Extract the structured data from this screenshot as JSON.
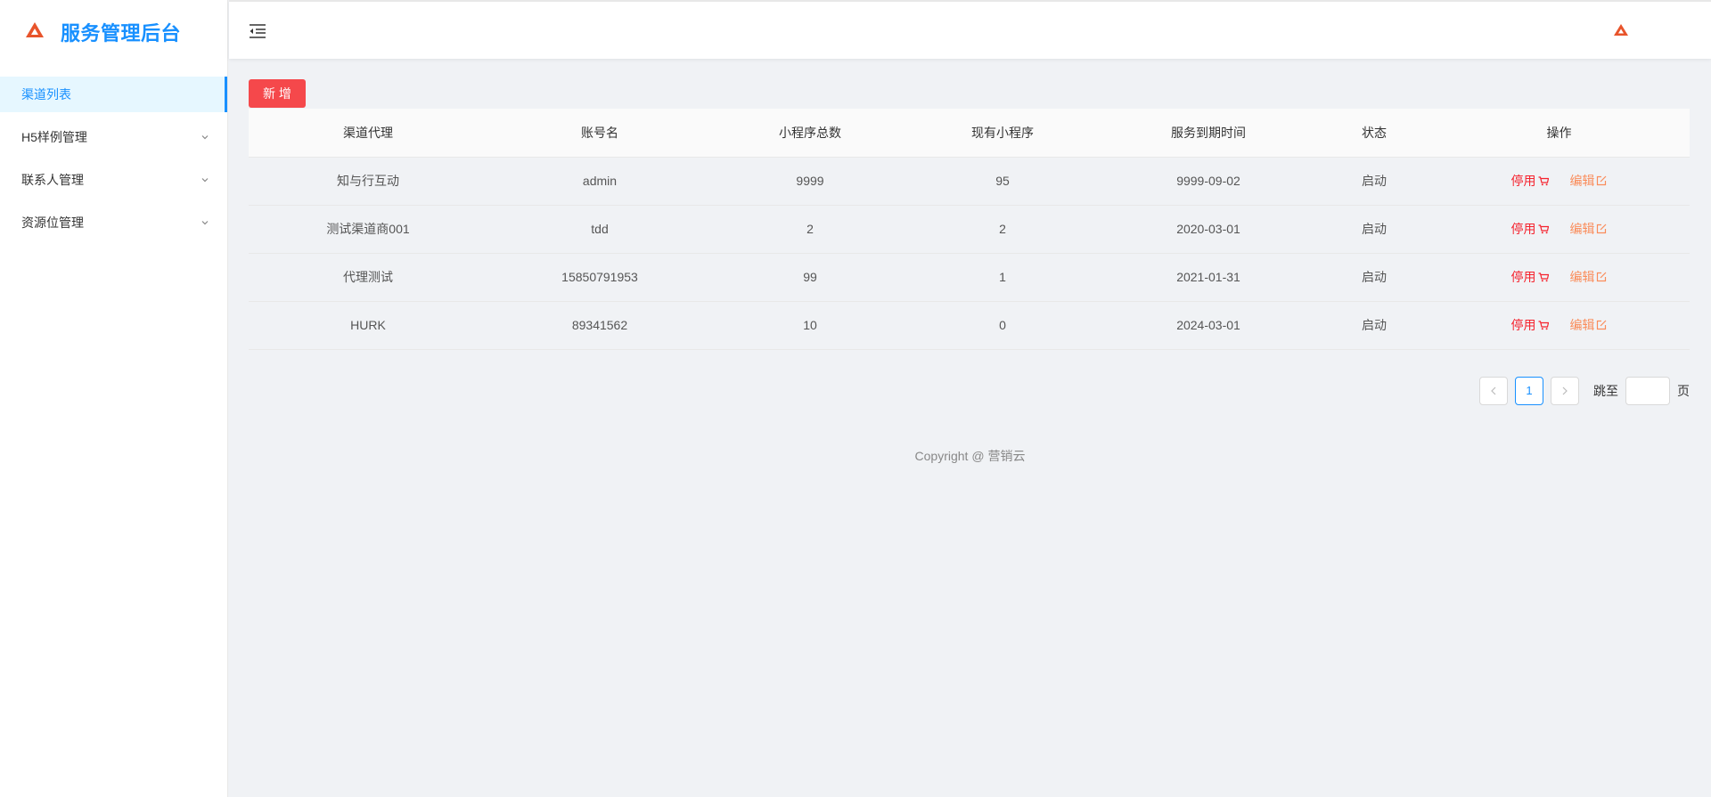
{
  "brand": {
    "title": "服务管理后台"
  },
  "sidebar": {
    "items": [
      {
        "label": "渠道列表",
        "active": true
      },
      {
        "label": "H5样例管理",
        "expandable": true
      },
      {
        "label": "联系人管理",
        "expandable": true
      },
      {
        "label": "资源位管理",
        "expandable": true
      }
    ]
  },
  "toolbar": {
    "add_label": "新 增"
  },
  "table": {
    "headers": [
      "渠道代理",
      "账号名",
      "小程序总数",
      "现有小程序",
      "服务到期时间",
      "状态",
      "操作"
    ],
    "rows": [
      [
        "知与行互动",
        "admin",
        "9999",
        "95",
        "9999-09-02",
        "启动"
      ],
      [
        "测试渠道商001",
        "tdd",
        "2",
        "2",
        "2020-03-01",
        "启动"
      ],
      [
        "代理测试",
        "15850791953",
        "99",
        "1",
        "2021-01-31",
        "启动"
      ],
      [
        "HURK",
        "89341562",
        "10",
        "0",
        "2024-03-01",
        "启动"
      ]
    ],
    "actions": {
      "stop": "停用",
      "edit": "编辑"
    }
  },
  "pagination": {
    "current_page": "1",
    "jump_label": "跳至",
    "page_suffix": "页",
    "jump_value": ""
  },
  "footer": {
    "copyright": "Copyright @ 营销云"
  },
  "colors": {
    "accent": "#1890ff",
    "add_button": "#f5484b",
    "stop_action": "#f5222d",
    "edit_action": "#fa8c5a",
    "logo": "#e8542b"
  }
}
